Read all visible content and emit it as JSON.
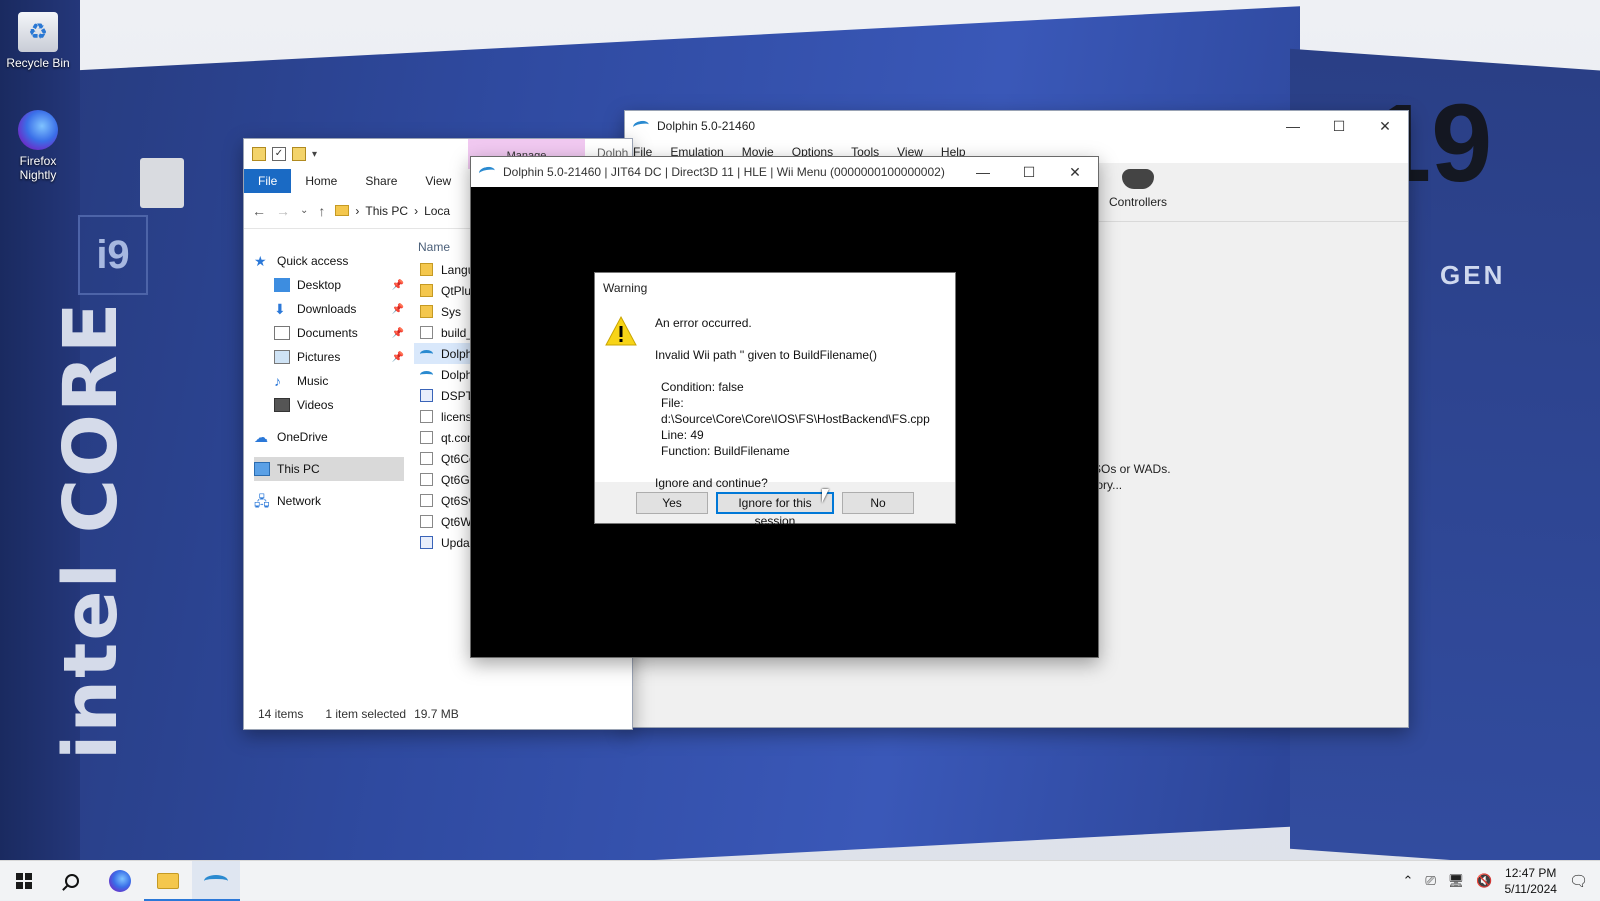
{
  "desktop": {
    "icons": [
      {
        "label": "Recycle Bin"
      },
      {
        "label": "Firefox Nightly"
      }
    ],
    "wallpaper": {
      "brand": "intel CORE",
      "gen": "GEN",
      "model": "i9"
    }
  },
  "explorer": {
    "manage_tab": "Manage",
    "ribbon_tabs": [
      "File",
      "Home",
      "Share",
      "View"
    ],
    "address": [
      "This PC",
      "Loca"
    ],
    "nav": [
      {
        "label": "Quick access"
      },
      {
        "label": "Desktop"
      },
      {
        "label": "Downloads"
      },
      {
        "label": "Documents"
      },
      {
        "label": "Pictures"
      },
      {
        "label": "Music"
      },
      {
        "label": "Videos"
      },
      {
        "label": "OneDrive"
      },
      {
        "label": "This PC"
      },
      {
        "label": "Network"
      }
    ],
    "column_name": "Name",
    "files": [
      {
        "name": "Langu",
        "type": "folder"
      },
      {
        "name": "QtPlug",
        "type": "folder"
      },
      {
        "name": "Sys",
        "type": "folder"
      },
      {
        "name": "build_",
        "type": "doc"
      },
      {
        "name": "Dolphi",
        "type": "dolphin"
      },
      {
        "name": "Dolphi",
        "type": "dolphin"
      },
      {
        "name": "DSPTo",
        "type": "exe"
      },
      {
        "name": "license",
        "type": "doc"
      },
      {
        "name": "qt.con",
        "type": "doc"
      },
      {
        "name": "Qt6Co",
        "type": "doc"
      },
      {
        "name": "Qt6Gu",
        "type": "doc"
      },
      {
        "name": "Qt6Sv",
        "type": "doc"
      },
      {
        "name": "Qt6Wi",
        "type": "doc"
      },
      {
        "name": "Updat",
        "type": "exe"
      }
    ],
    "status": {
      "items": "14 items",
      "selected": "1 item selected",
      "size": "19.7 MB"
    }
  },
  "dolphin_main": {
    "title": "Dolphin 5.0-21460",
    "partial_tab": "Dolph",
    "menu": [
      "File",
      "Emulation",
      "Movie",
      "Options",
      "Tools",
      "View",
      "Help"
    ],
    "controllers_label": "Controllers",
    "hint_line1": "SOs or WADs.",
    "hint_line2": "tory..."
  },
  "render_window": {
    "title": "Dolphin 5.0-21460 | JIT64 DC | Direct3D 11 | HLE | Wii Menu (0000000100000002)"
  },
  "warning_dialog": {
    "title": "Warning",
    "line1": "An error occurred.",
    "line2": "Invalid Wii path '' given to BuildFilename()",
    "condition": "Condition: false",
    "file": "File: d:\\Source\\Core\\Core\\IOS\\FS\\HostBackend\\FS.cpp",
    "line": "Line: 49",
    "function": "Function: BuildFilename",
    "question": "Ignore and continue?",
    "buttons": {
      "yes": "Yes",
      "ignore": "Ignore for this session",
      "no": "No"
    }
  },
  "taskbar": {
    "time": "12:47 PM",
    "date": "5/11/2024"
  },
  "colors": {
    "accent": "#0078d7",
    "file_tab": "#1a6ac4",
    "manage_tab": "#f1c9f1",
    "render_bg": "#000000"
  }
}
